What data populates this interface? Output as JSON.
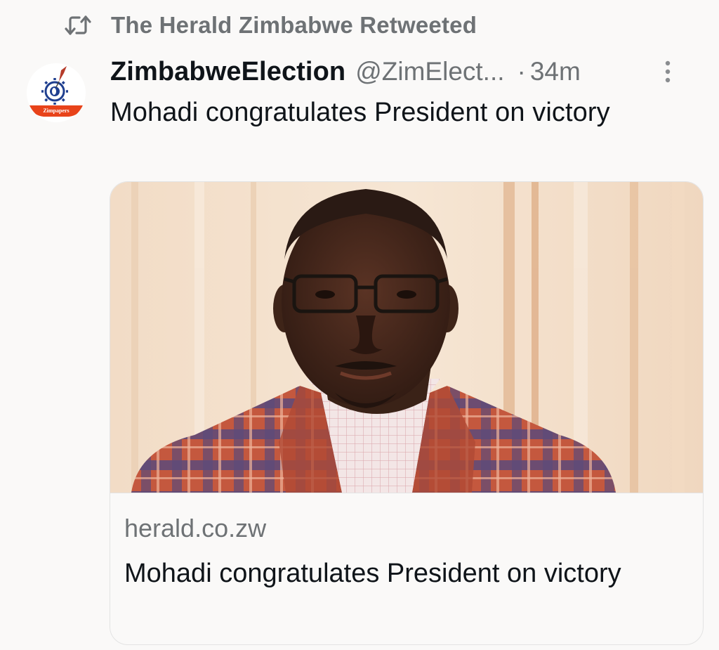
{
  "retweet": {
    "icon": "retweet-icon",
    "label": "The Herald Zimbabwe Retweeted"
  },
  "author": {
    "display_name": "ZimbabweElection",
    "handle": "@ZimElect...",
    "separator": "·",
    "timestamp": "34m",
    "avatar_text": "Zimpapers",
    "avatar_colors": {
      "ring": "#ffffff",
      "bowl": "#e8431a",
      "gear": "#1f3f8f"
    }
  },
  "tweet": {
    "text": "Mohadi congratulates President on victory"
  },
  "card": {
    "domain": "herald.co.zw",
    "title": "Mohadi congratulates President on victory",
    "image_alt": "Portrait of a man in glasses and a plaid blazer"
  },
  "colors": {
    "background": "#faf9f8",
    "text_primary": "#0f1419",
    "text_secondary": "#6e7275",
    "border": "#e3e3e3"
  }
}
